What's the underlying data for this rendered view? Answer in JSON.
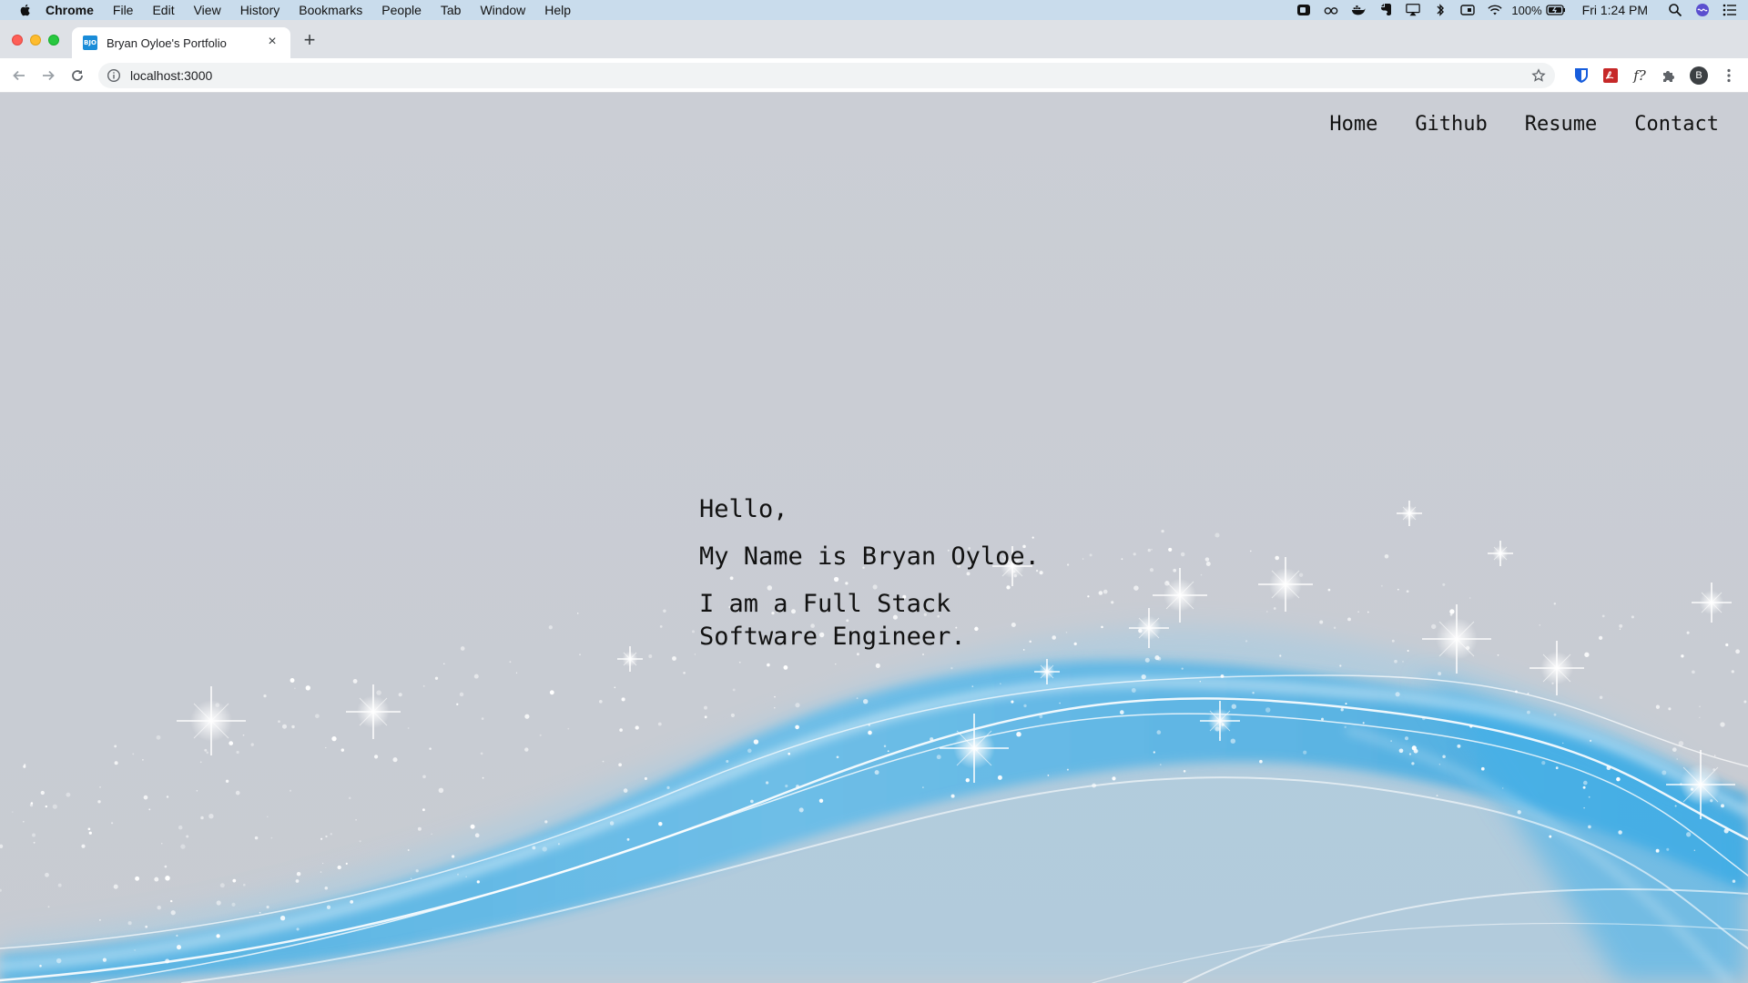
{
  "menubar": {
    "app_name": "Chrome",
    "items": [
      "File",
      "Edit",
      "View",
      "History",
      "Bookmarks",
      "People",
      "Tab",
      "Window",
      "Help"
    ],
    "battery": "100%",
    "clock": "Fri 1:24 PM"
  },
  "browser": {
    "tab_title": "Bryan Oyloe's Portfolio",
    "favicon_text": "BJO",
    "url": "localhost:3000",
    "profile_initial": "B",
    "extension_fx": "f?"
  },
  "site": {
    "nav": [
      "Home",
      "Github",
      "Resume",
      "Contact"
    ],
    "hero": {
      "greeting": "Hello,",
      "name_line": "My Name is Bryan Oyloe.",
      "role_line": "I am a Full Stack Software Engineer."
    }
  },
  "colors": {
    "page_background": "#cbced5",
    "wave_blue": "#1aa3e8",
    "wave_light": "#8fd3f7"
  }
}
